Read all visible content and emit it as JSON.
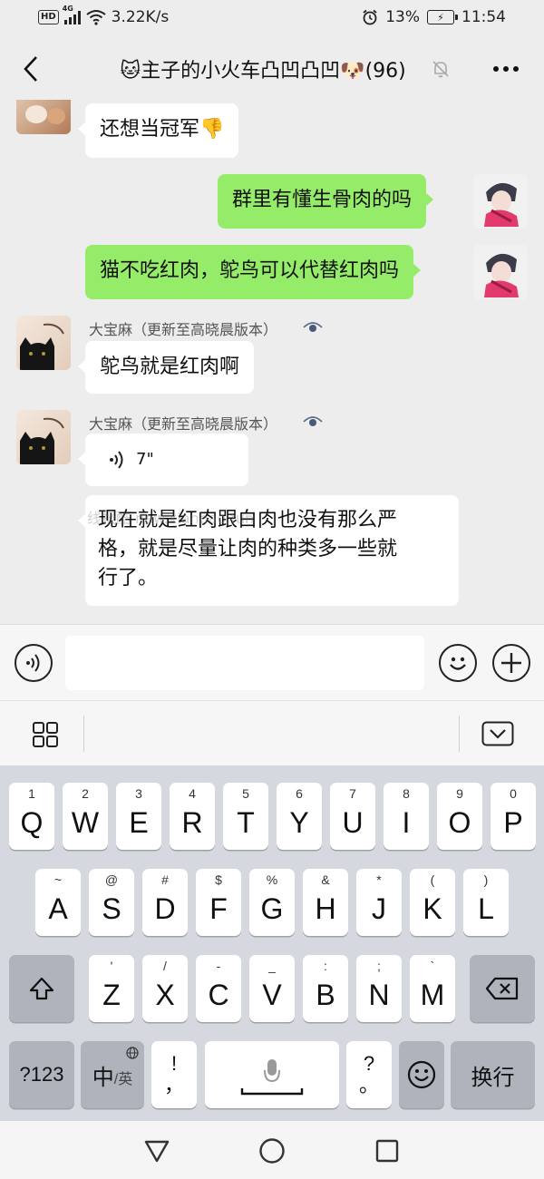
{
  "status_bar": {
    "hd": "HD",
    "network": "4G",
    "speed": "3.22K/s",
    "battery_percent": "13%",
    "time": "11:54"
  },
  "header": {
    "title": "🐱主子的小火车凸凹凸凹🐶(96)",
    "back_icon": "chevron-left-icon",
    "mute_icon": "bell-muted-icon",
    "more_icon": "more-dots-icon"
  },
  "messages": [
    {
      "direction": "in",
      "text": "还想当冠军👎"
    },
    {
      "direction": "out",
      "text": "群里有懂生骨肉的吗"
    },
    {
      "direction": "out",
      "text": "猫不吃红肉，鸵鸟可以代替红肉吗"
    },
    {
      "direction": "in",
      "sender": "大宝麻（更新至高晓晨版本）",
      "text": "鸵鸟就是红肉啊"
    },
    {
      "direction": "in",
      "sender": "大宝麻（更新至高晓晨版本）",
      "type": "voice",
      "duration": "7\""
    },
    {
      "direction": "in",
      "text_lines": [
        "现在就是红肉跟白肉也没有那么严",
        "格，就是尽量让肉的种类多一些就",
        "行了。"
      ]
    }
  ],
  "watermark": "线报酷 new.xianbao.fun",
  "input_bar": {
    "voice_icon": "voice-icon",
    "emoji_icon": "emoji-icon",
    "plus_icon": "plus-icon",
    "input_value": ""
  },
  "keyboard": {
    "row1": [
      {
        "main": "Q",
        "sub": "1"
      },
      {
        "main": "W",
        "sub": "2"
      },
      {
        "main": "E",
        "sub": "3"
      },
      {
        "main": "R",
        "sub": "4"
      },
      {
        "main": "T",
        "sub": "5"
      },
      {
        "main": "Y",
        "sub": "6"
      },
      {
        "main": "U",
        "sub": "7"
      },
      {
        "main": "I",
        "sub": "8"
      },
      {
        "main": "O",
        "sub": "9"
      },
      {
        "main": "P",
        "sub": "0"
      }
    ],
    "row2": [
      {
        "main": "A",
        "sub": "~"
      },
      {
        "main": "S",
        "sub": "@"
      },
      {
        "main": "D",
        "sub": "#"
      },
      {
        "main": "F",
        "sub": "$"
      },
      {
        "main": "G",
        "sub": "%"
      },
      {
        "main": "H",
        "sub": "&"
      },
      {
        "main": "J",
        "sub": "*"
      },
      {
        "main": "K",
        "sub": "("
      },
      {
        "main": "L",
        "sub": ")"
      }
    ],
    "row3": [
      {
        "main": "Z",
        "sub": "'"
      },
      {
        "main": "X",
        "sub": "/"
      },
      {
        "main": "C",
        "sub": "-"
      },
      {
        "main": "V",
        "sub": "_"
      },
      {
        "main": "B",
        "sub": ":"
      },
      {
        "main": "N",
        "sub": ";"
      },
      {
        "main": "M",
        "sub": "`"
      }
    ],
    "num_key": "?123",
    "lang_main": "中",
    "lang_sub": "/英",
    "punct_top": "!",
    "punct_bottom": "，",
    "punct2_top": "?",
    "punct2_bottom": "。",
    "enter_key": "换行"
  },
  "colors": {
    "background": "#ededed",
    "outgoing_bubble": "#95ec69",
    "incoming_bubble": "#ffffff",
    "keyboard_bg": "#d5d8de"
  }
}
